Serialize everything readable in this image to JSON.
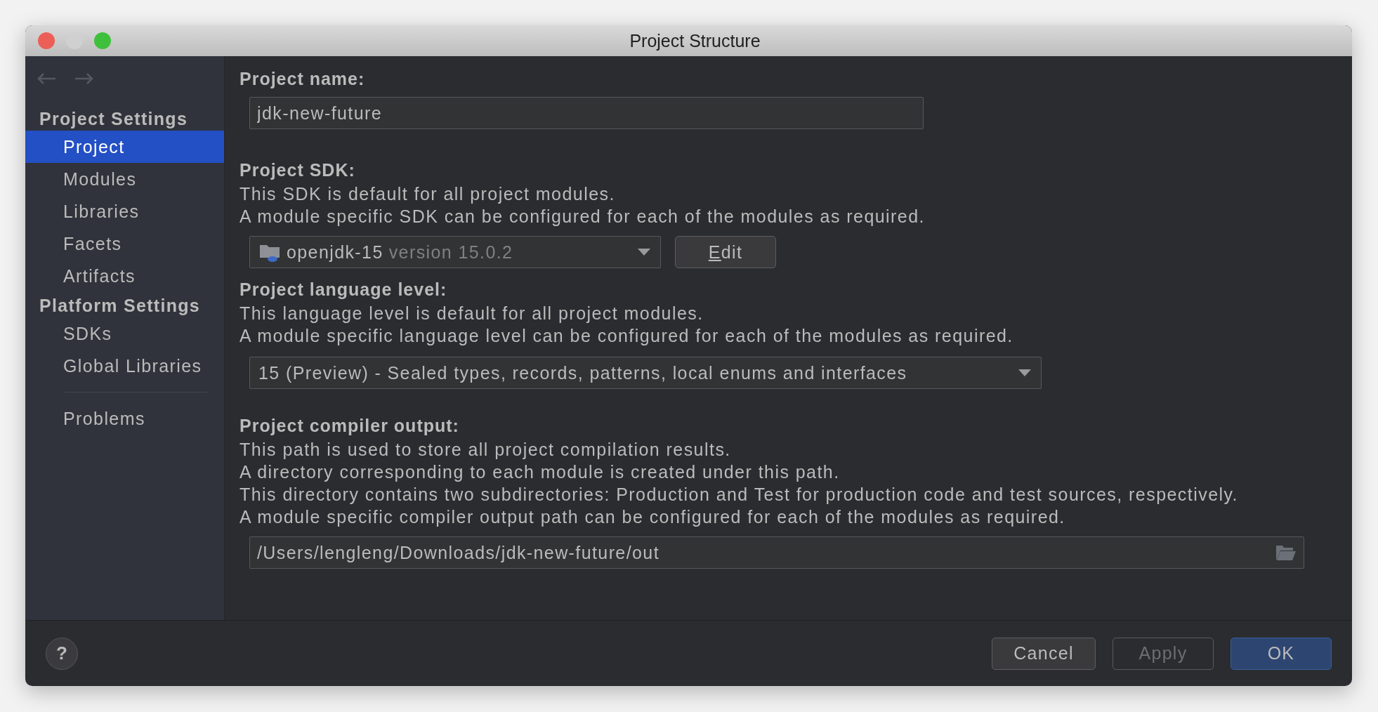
{
  "window": {
    "title": "Project Structure"
  },
  "sidebar": {
    "groups": [
      {
        "header": "Project Settings",
        "items": [
          {
            "label": "Project",
            "selected": true
          },
          {
            "label": "Modules",
            "selected": false
          },
          {
            "label": "Libraries",
            "selected": false
          },
          {
            "label": "Facets",
            "selected": false
          },
          {
            "label": "Artifacts",
            "selected": false
          }
        ]
      },
      {
        "header": "Platform Settings",
        "items": [
          {
            "label": "SDKs",
            "selected": false
          },
          {
            "label": "Global Libraries",
            "selected": false
          }
        ]
      },
      {
        "items": [
          {
            "label": "Problems",
            "selected": false
          }
        ]
      }
    ]
  },
  "sections": [
    {
      "kind": "text",
      "title": "Project name:",
      "value": "jdk-new-future"
    },
    {
      "kind": "sdk",
      "title": "Project SDK:",
      "lines": [
        "This SDK is default for all project modules.",
        "A module specific SDK can be configured for each of the modules as required."
      ],
      "sdk_name": "openjdk-15",
      "sdk_version": "version 15.0.2",
      "edit_button": "Edit"
    },
    {
      "kind": "select",
      "title": "Project language level:",
      "lines": [
        "This language level is default for all project modules.",
        "A module specific language level can be configured for each of the modules as required."
      ],
      "value": "15 (Preview) - Sealed types, records, patterns, local enums and interfaces"
    },
    {
      "kind": "path",
      "title": "Project compiler output:",
      "lines": [
        "This path is used to store all project compilation results.",
        "A directory corresponding to each module is created under this path.",
        "This directory contains two subdirectories: Production and Test for production code and test sources, respectively.",
        "A module specific compiler output path can be configured for each of the modules as required."
      ],
      "value": "/Users/lengleng/Downloads/jdk-new-future/out"
    }
  ],
  "footer": {
    "help": "?",
    "buttons": [
      {
        "label": "Cancel",
        "disabled": false,
        "default": false
      },
      {
        "label": "Apply",
        "disabled": true,
        "default": false
      },
      {
        "label": "OK",
        "disabled": false,
        "default": true
      }
    ]
  }
}
